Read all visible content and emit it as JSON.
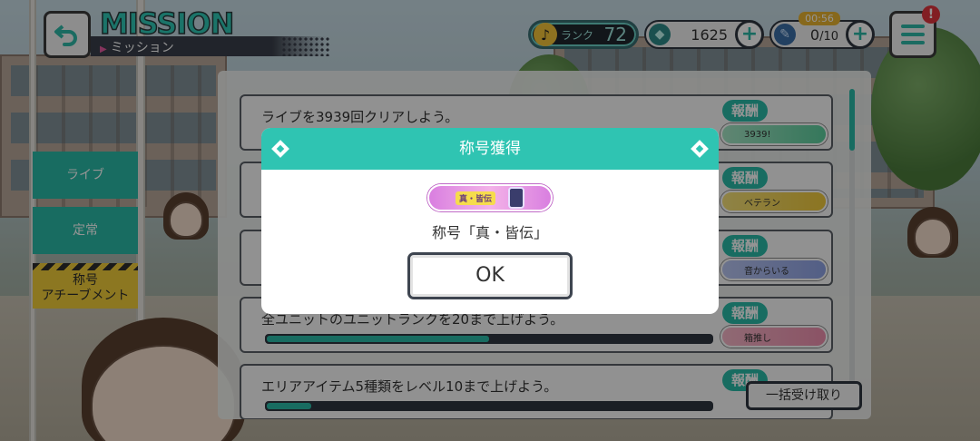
{
  "header": {
    "title": "MISSION",
    "subtitle": "ミッション"
  },
  "hud": {
    "rank_label": "ランク",
    "rank_value": "72",
    "gems": "1625",
    "stamina_current": "0",
    "stamina_max": "/10",
    "timer": "00:56",
    "notification_badge": "!"
  },
  "tabs": [
    {
      "label": "ライブ"
    },
    {
      "label": "定常"
    },
    {
      "label": "称号\nアチーブメント"
    }
  ],
  "missions": [
    {
      "text": "ライブを3939回クリアしよう。",
      "reward_label": "報酬",
      "reward": "3939!",
      "progress": null
    },
    {
      "text": "",
      "reward_label": "報酬",
      "reward": "ベテラン",
      "progress": null
    },
    {
      "text": "",
      "reward_label": "報酬",
      "reward": "音からいる",
      "progress": null
    },
    {
      "text": "全ユニットのユニットランクを20まで上げよう。",
      "reward_label": "報酬",
      "reward": "箱推し",
      "progress": 0.5
    },
    {
      "text": "エリアアイテム5種類をレベル10まで上げよう。",
      "reward_label": "報酬",
      "reward": "",
      "progress": 0.1
    }
  ],
  "bulk_button": "一括受け取り",
  "modal": {
    "title": "称号獲得",
    "plate_text": "真・皆伝",
    "message": "称号「真・皆伝」",
    "ok_label": "OK"
  },
  "colors": {
    "accent": "#2fc4b2",
    "achievement_tab": "#f1cd3a",
    "dark": "#2f3640",
    "badge": "#e0353d"
  }
}
